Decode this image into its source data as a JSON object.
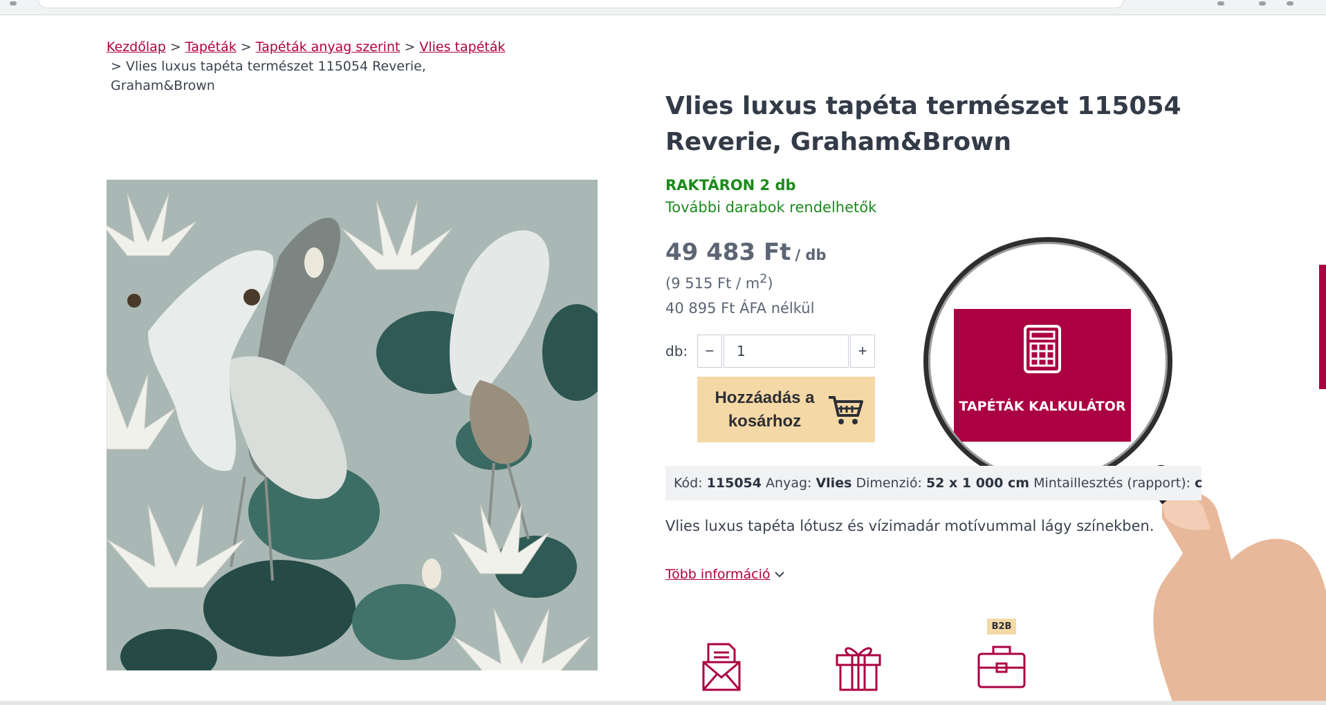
{
  "breadcrumb": {
    "items": [
      {
        "label": "Kezdőlap"
      },
      {
        "label": "Tapéták"
      },
      {
        "label": "Tapéták anyag szerint"
      },
      {
        "label": "Vlies tapéták"
      }
    ],
    "separator": ">",
    "current": "> Vlies luxus tapéta természet 115054 Reverie, Graham&Brown"
  },
  "product": {
    "title": "Vlies luxus tapéta természet 115054 Reverie, Graham&Brown",
    "stock": "RAKTÁRON 2 db",
    "stock_note": "További darabok rendelhetők",
    "price": "49 483 Ft",
    "price_unit": "/ db",
    "price_m2_prefix": "(9 515 Ft / m",
    "price_m2_sup": "2",
    "price_m2_suffix": ")",
    "price_net": "40 895 Ft ÁFA nélkül",
    "description": "Vlies luxus tapéta lótusz és vízimadár motívummal lágy színekben."
  },
  "quantity": {
    "label": "db:",
    "minus": "−",
    "plus": "+",
    "value": "1"
  },
  "cart": {
    "label": "Hozzáadás a kosárhoz",
    "icon": "shopping-cart-icon"
  },
  "calculator": {
    "label": "TAPÉTÁK KALKULÁTOR",
    "icon": "calculator-icon"
  },
  "specs": {
    "code_label": "Kód:",
    "code": "115054",
    "material_label": "Anyag:",
    "material": "Vlies",
    "dimension_label": "Dimenzió:",
    "dimension": "52 x 1 000 cm",
    "rapport_label": "Mintaillesztés (rapport):",
    "rapport": "cm"
  },
  "more_info": "Több információ",
  "bottom_icons": {
    "icons": [
      "envelope-letter-icon",
      "gift-icon",
      "briefcase-icon"
    ],
    "b2b_badge": "B2B"
  },
  "colors": {
    "brand": "#ab0041",
    "link": "#b0003a",
    "stock_green": "#1b8a1b",
    "cart_button": "#f4d8a6",
    "specs_bg": "#f1f2f4"
  }
}
